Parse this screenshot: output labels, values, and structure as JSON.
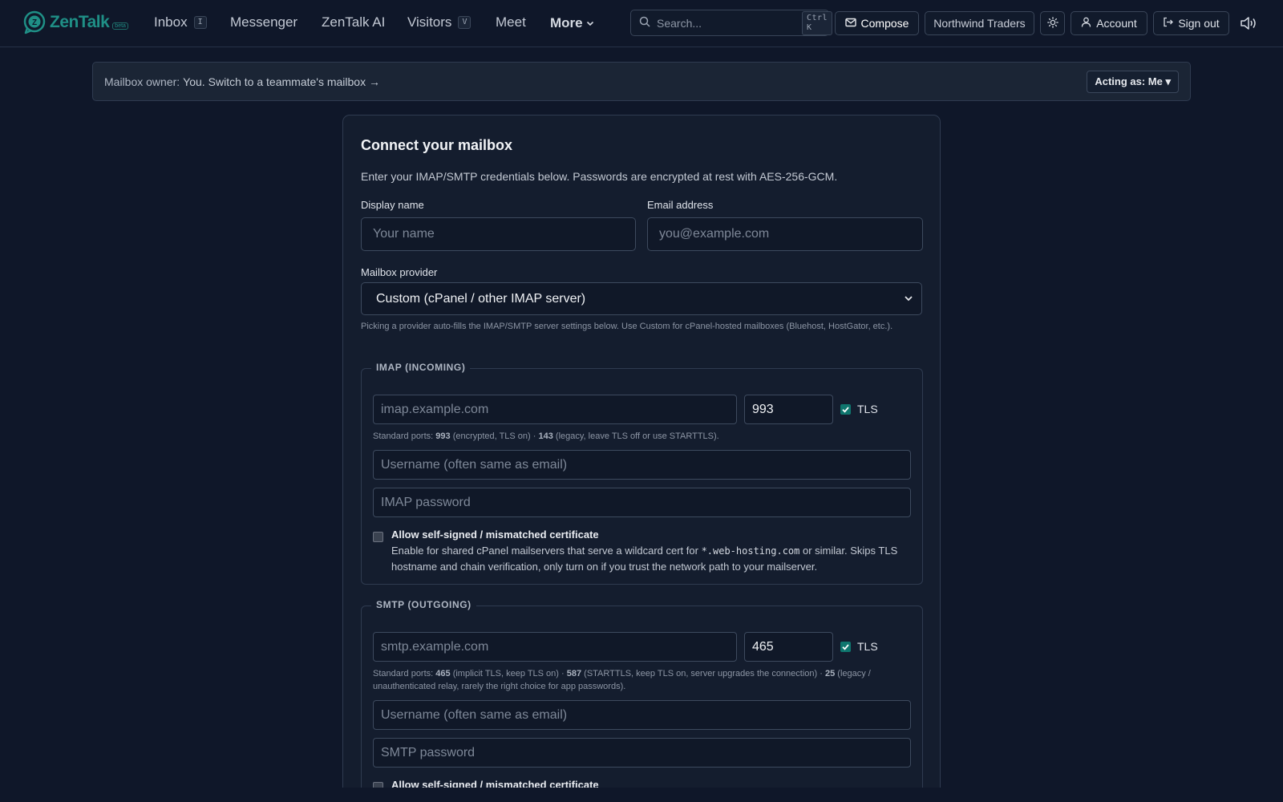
{
  "app": {
    "logo_text": "ZenTalk",
    "logo_badge": "beta",
    "logo_mark_letter": "Z"
  },
  "nav": {
    "items": [
      {
        "label": "Inbox",
        "shortcut": "I"
      },
      {
        "label": "Messenger"
      },
      {
        "label": "ZenTalk AI"
      },
      {
        "label": "Visitors",
        "shortcut": "V"
      },
      {
        "label": "Meet"
      }
    ],
    "more_label": "More"
  },
  "search": {
    "placeholder": "Search...",
    "shortcut": "Ctrl K"
  },
  "toolbar": {
    "compose_label": "Compose",
    "org_label": "Northwind Traders",
    "account_label": "Account",
    "signout_label": "Sign out",
    "icons": {
      "theme": "sun-icon",
      "sound": "speaker-icon",
      "compose": "mail-icon",
      "account": "user-icon",
      "signout": "logout-icon"
    }
  },
  "owner_banner": {
    "label": "Mailbox owner:",
    "value": "You.",
    "switch_link": "Switch to a teammate's mailbox →",
    "acting_label": "Acting as: Me ▾"
  },
  "form": {
    "title": "Connect your mailbox",
    "description": "Enter your IMAP/SMTP credentials below. Passwords are encrypted at rest with AES-256-GCM.",
    "display_name": {
      "label": "Display name",
      "placeholder": "Your name",
      "value": ""
    },
    "email": {
      "label": "Email address",
      "placeholder": "you@example.com",
      "value": ""
    },
    "provider": {
      "label": "Mailbox provider",
      "selected": "Custom (cPanel / other IMAP server)",
      "hint": "Picking a provider auto-fills the IMAP/SMTP server settings below. Use Custom for cPanel-hosted mailboxes (Bluehost, HostGator, etc.)."
    },
    "imap": {
      "legend": "IMAP (INCOMING)",
      "host_placeholder": "imap.example.com",
      "port": "993",
      "tls_label": "TLS",
      "tls_checked": true,
      "ports_hint": {
        "prefix": "Standard ports: ",
        "port_a": "993",
        "text_a": " (encrypted, TLS on) · ",
        "port_b": "143",
        "text_b": " (legacy, leave TLS off or use STARTTLS)."
      },
      "username_placeholder": "Username (often same as email)",
      "password_placeholder": "IMAP password",
      "self_signed": {
        "title": "Allow self-signed / mismatched certificate",
        "desc_a": "Enable for shared cPanel mailservers that serve a wildcard cert for ",
        "desc_code": "*.web-hosting.com",
        "desc_b": " or similar. Skips TLS hostname and chain verification, only turn on if you trust the network path to your mailserver.",
        "checked": false
      }
    },
    "smtp": {
      "legend": "SMTP (OUTGOING)",
      "host_placeholder": "smtp.example.com",
      "port": "465",
      "tls_label": "TLS",
      "tls_checked": true,
      "ports_hint": {
        "prefix": "Standard ports: ",
        "port_a": "465",
        "text_a": " (implicit TLS, keep TLS on) · ",
        "port_b": "587",
        "text_b": " (STARTTLS, keep TLS on, server upgrades the connection) · ",
        "port_c": "25",
        "text_c": " (legacy / unauthenticated relay, rarely the right choice for app passwords)."
      },
      "username_placeholder": "Username (often same as email)",
      "password_placeholder": "SMTP password",
      "self_signed": {
        "title": "Allow self-signed / mismatched certificate",
        "checked": false
      }
    }
  },
  "colors": {
    "background": "#0f1729",
    "card": "#141d2e",
    "accent": "#0f766e",
    "brand": "#1f8f86"
  }
}
